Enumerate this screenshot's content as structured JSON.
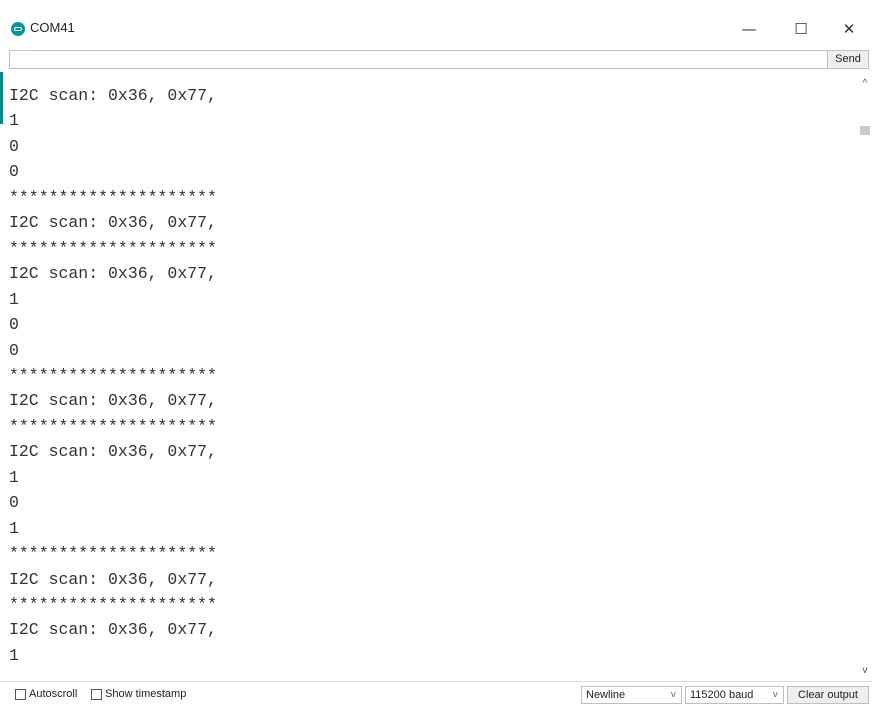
{
  "window": {
    "title": "COM41",
    "controls": {
      "minimize": "—",
      "maximize": "☐",
      "close": "✕"
    }
  },
  "input": {
    "value": "",
    "placeholder": ""
  },
  "send_label": "Send",
  "output_lines": [
    "I2C scan: 0x36, 0x77,",
    "1",
    "0",
    "0",
    "*********************",
    "I2C scan: 0x36, 0x77,",
    "*********************",
    "I2C scan: 0x36, 0x77,",
    "1",
    "0",
    "0",
    "*********************",
    "I2C scan: 0x36, 0x77,",
    "*********************",
    "I2C scan: 0x36, 0x77,",
    "1",
    "0",
    "1",
    "*********************",
    "I2C scan: 0x36, 0x77,",
    "*********************",
    "I2C scan: 0x36, 0x77,",
    "1"
  ],
  "scrollbar": {
    "up_glyph": "^",
    "down_glyph": "v"
  },
  "statusbar": {
    "autoscroll": {
      "label": "Autoscroll",
      "checked": false
    },
    "timestamp": {
      "label": "Show timestamp",
      "checked": false
    },
    "line_ending": "Newline",
    "baud_rate": "115200 baud",
    "clear_label": "Clear output",
    "dropdown_glyph": "v"
  }
}
